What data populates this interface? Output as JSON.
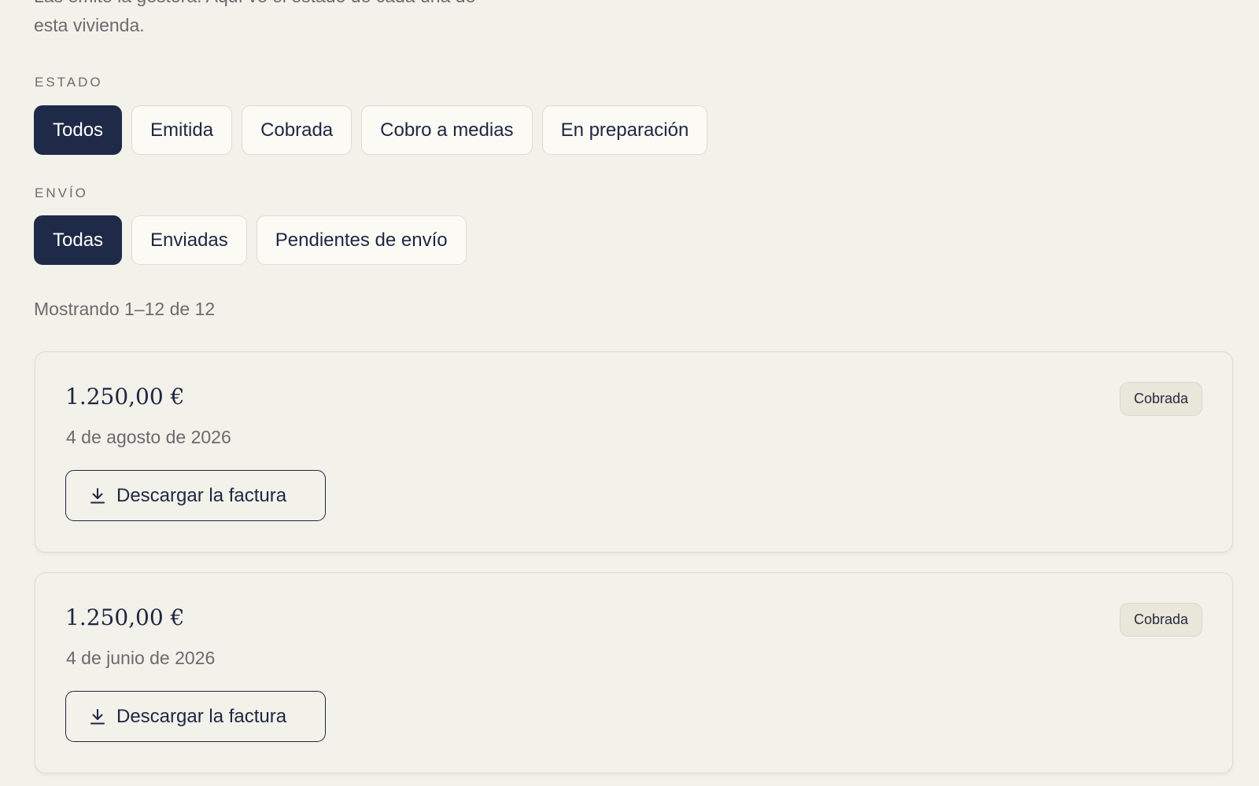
{
  "intro": {
    "line1": "Las emite la gestora. Aquí ve el estado de cada una de",
    "line2": "esta vivienda."
  },
  "filters": {
    "estado": {
      "label": "ESTADO",
      "options": [
        "Todos",
        "Emitida",
        "Cobrada",
        "Cobro a medias",
        "En preparación"
      ],
      "selected": "Todos"
    },
    "envio": {
      "label": "ENVÍO",
      "options": [
        "Todas",
        "Enviadas",
        "Pendientes de envío"
      ],
      "selected": "Todas"
    }
  },
  "results": {
    "count_text": "Mostrando 1–12 de 12"
  },
  "invoices": [
    {
      "amount": "1.250,00 €",
      "date": "4 de agosto de 2026",
      "status": "Cobrada",
      "download_label": "Descargar la factura",
      "icon": "download-icon"
    },
    {
      "amount": "1.250,00 €",
      "date": "4 de junio de 2026",
      "status": "Cobrada",
      "download_label": "Descargar la factura",
      "icon": "download-icon"
    }
  ],
  "colors": {
    "background": "#f3f2ea",
    "primary": "#1f2a48",
    "muted_text": "#6a6a6f",
    "badge_bg": "#e9e6da"
  }
}
